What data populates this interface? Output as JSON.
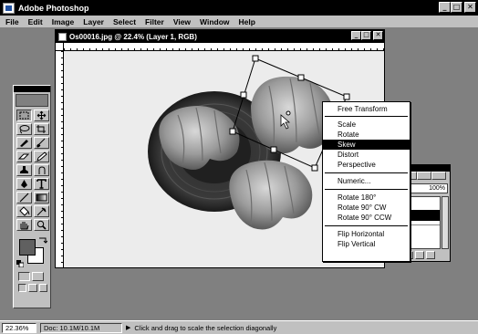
{
  "app": {
    "title": "Adobe Photoshop"
  },
  "menu": [
    "File",
    "Edit",
    "Image",
    "Layer",
    "Select",
    "Filter",
    "View",
    "Window",
    "Help"
  ],
  "window_controls": {
    "minimize": "_",
    "maximize": "□",
    "close": "✕"
  },
  "document": {
    "title": "Os00016.jpg @ 22.4% (Layer 1, RGB)"
  },
  "context_menu": {
    "items": [
      {
        "label": "Free Transform",
        "highlighted": false
      },
      {
        "label": "Scale",
        "highlighted": false
      },
      {
        "label": "Rotate",
        "highlighted": false
      },
      {
        "label": "Skew",
        "highlighted": true
      },
      {
        "label": "Distort",
        "highlighted": false
      },
      {
        "label": "Perspective",
        "highlighted": false
      },
      {
        "label": "Numeric...",
        "highlighted": false
      },
      {
        "label": "Rotate 180°",
        "highlighted": false
      },
      {
        "label": "Rotate 90° CW",
        "highlighted": false
      },
      {
        "label": "Rotate 90° CCW",
        "highlighted": false
      },
      {
        "label": "Flip Horizontal",
        "highlighted": false
      },
      {
        "label": "Flip Vertical",
        "highlighted": false
      }
    ]
  },
  "palette": {
    "opacity": "100%"
  },
  "status": {
    "zoom": "22.36%",
    "doc_size": "Doc: 10.1M/10.1M",
    "hint": "Click and drag to scale the selection diagonally"
  },
  "colors": {
    "title_bar": "#000000",
    "chrome": "#c0c0c0",
    "workspace": "#808080",
    "highlight": "#000000"
  },
  "tools": [
    "marquee-icon",
    "move-icon",
    "lasso-icon",
    "crop-icon",
    "airbrush-icon",
    "paintbrush-icon",
    "eraser-icon",
    "pencil-icon",
    "rubber-stamp-icon",
    "smudge-icon",
    "pen-icon",
    "type-icon",
    "line-icon",
    "gradient-icon",
    "paint-bucket-icon",
    "eyedropper-icon",
    "hand-icon",
    "zoom-icon"
  ]
}
